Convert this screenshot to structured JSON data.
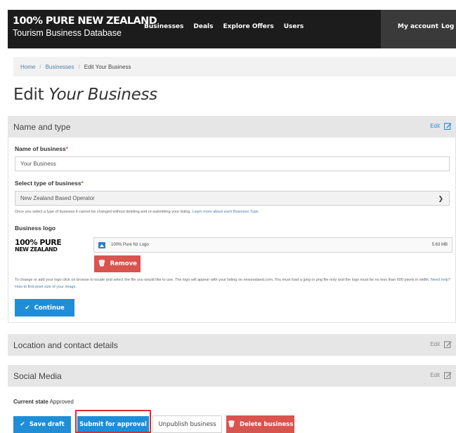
{
  "header": {
    "brand_line1": "100% PURE NEW ZEALAND",
    "brand_line2": "Tourism Business Database",
    "nav": [
      "Businesses",
      "Deals",
      "Explore Offers",
      "Users"
    ],
    "my_account": "My account",
    "logout": "Log ou"
  },
  "breadcrumb": {
    "home": "Home",
    "sep": "/",
    "businesses": "Businesses",
    "current": "Edit Your Business"
  },
  "page": {
    "title_plain": "Edit",
    "title_italic": "Your Business"
  },
  "name_panel": {
    "heading": "Name and type",
    "edit_label": "Edit",
    "business_name_label": "Name of business",
    "required_mark": "*",
    "business_name_value": "Your Business",
    "type_label": "Select type of business",
    "type_value": "New Zealand Based Operator",
    "type_note": "Once you select a type of business it cannot be changed without deleting and re-submitting your listing.",
    "type_note_link": "Learn more about each Business Type.",
    "logo_label": "Business logo",
    "logo_line1": "100% PURE",
    "logo_line2": "NEW ZEALAND",
    "file_name": "100% Pure Nz Logo",
    "file_size": "5.63 MB",
    "remove_label": "Remove",
    "logo_note": "To change or add your logo click on browse to locate and select the file you would like to use. The logo will appear with your listing on newzealand.com. You must load a jpeg or png file only and the logo must be no less than 600 pixels in width.",
    "logo_note_link": "Need help? How to find pixel size of your image.",
    "continue_label": "Continue"
  },
  "location_panel": {
    "heading": "Location and contact details",
    "edit_label": "Edit"
  },
  "social_panel": {
    "heading": "Social Media",
    "edit_label": "Edit"
  },
  "status": {
    "label": "Current state",
    "value": "Approved"
  },
  "actions": {
    "save_draft": "Save draft",
    "submit": "Submit for approval",
    "unpublish": "Unpublish business",
    "delete": "Delete business"
  },
  "colors": {
    "header_bg": "#1c1c1c",
    "primary_blue": "#1f8ed6",
    "danger_red": "#d9534f",
    "highlight_red": "#d63030"
  }
}
